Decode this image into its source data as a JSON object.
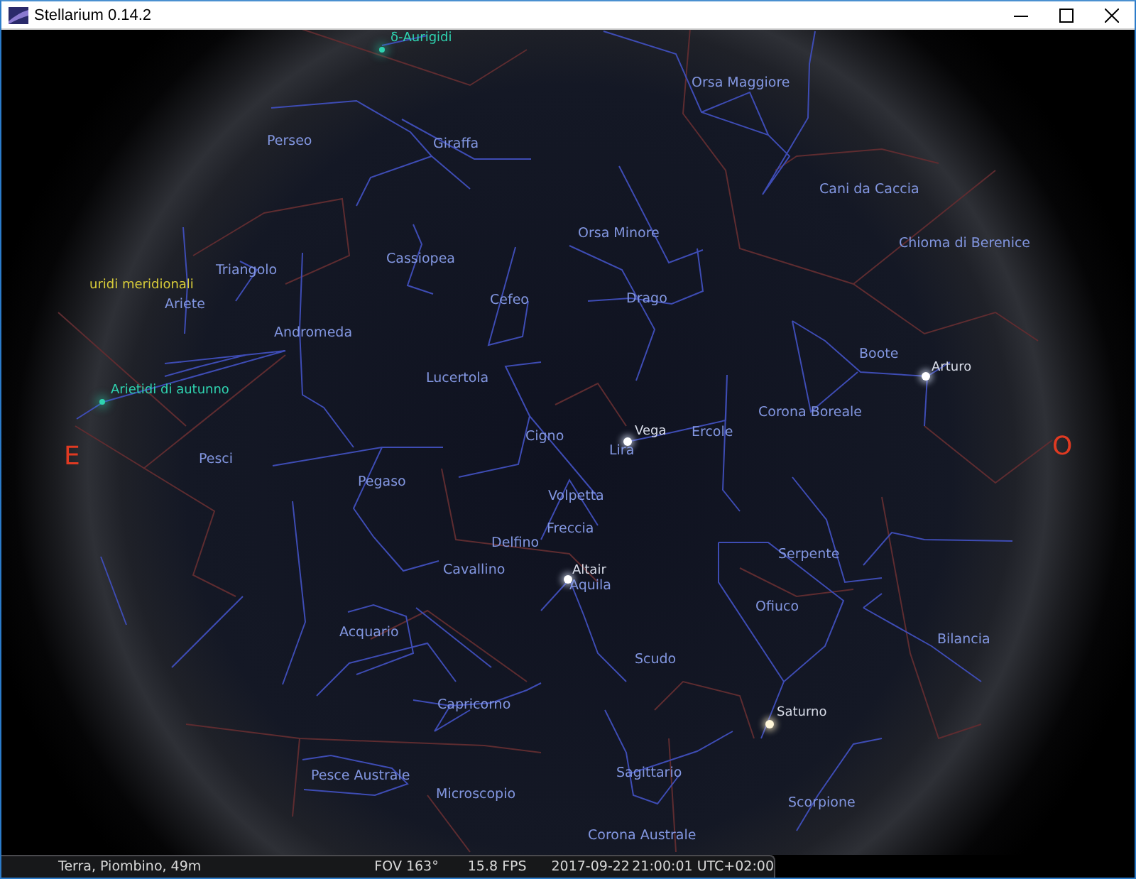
{
  "window": {
    "title": "Stellarium 0.14.2"
  },
  "sky_labels": [
    {
      "kind": "meteor_shower",
      "text": "δ-Aurigidi",
      "color": "#2fd3b0"
    },
    {
      "kind": "constellation",
      "text": "Orsa Maggiore"
    },
    {
      "kind": "constellation",
      "text": "Perseo"
    },
    {
      "kind": "constellation",
      "text": "Giraffa"
    },
    {
      "kind": "constellation",
      "text": "Cani da Caccia"
    },
    {
      "kind": "constellation",
      "text": "Orsa Minore"
    },
    {
      "kind": "constellation",
      "text": "Chioma di Berenice"
    },
    {
      "kind": "constellation",
      "text": "Cassiopea"
    },
    {
      "kind": "constellation",
      "text": "Triangolo"
    },
    {
      "kind": "meteor_shower",
      "text": "uridi meridionali",
      "color": "#d8cc3a"
    },
    {
      "kind": "constellation",
      "text": "Ariete"
    },
    {
      "kind": "constellation",
      "text": "Cefeo"
    },
    {
      "kind": "constellation",
      "text": "Drago"
    },
    {
      "kind": "constellation",
      "text": "Andromeda"
    },
    {
      "kind": "constellation",
      "text": "Boote"
    },
    {
      "kind": "star",
      "text": "Arturo"
    },
    {
      "kind": "constellation",
      "text": "Lucertola"
    },
    {
      "kind": "meteor_shower",
      "text": "Arietidi di autunno",
      "color": "#2fd3b0"
    },
    {
      "kind": "constellation",
      "text": "Corona Boreale"
    },
    {
      "kind": "constellation",
      "text": "Cigno"
    },
    {
      "kind": "star",
      "text": "Vega"
    },
    {
      "kind": "constellation",
      "text": "Ercole"
    },
    {
      "kind": "cardinal",
      "text": "E"
    },
    {
      "kind": "constellation",
      "text": "Pesci"
    },
    {
      "kind": "constellation",
      "text": "Lira"
    },
    {
      "kind": "cardinal",
      "text": "O"
    },
    {
      "kind": "constellation",
      "text": "Pegaso"
    },
    {
      "kind": "constellation",
      "text": "Volpetta"
    },
    {
      "kind": "constellation",
      "text": "Freccia"
    },
    {
      "kind": "constellation",
      "text": "Delfino"
    },
    {
      "kind": "constellation",
      "text": "Serpente"
    },
    {
      "kind": "constellation",
      "text": "Cavallino"
    },
    {
      "kind": "star",
      "text": "Altair"
    },
    {
      "kind": "constellation",
      "text": "Aquila"
    },
    {
      "kind": "constellation",
      "text": "Ofiuco"
    },
    {
      "kind": "constellation",
      "text": "Acquario"
    },
    {
      "kind": "constellation",
      "text": "Bilancia"
    },
    {
      "kind": "constellation",
      "text": "Scudo"
    },
    {
      "kind": "constellation",
      "text": "Capricorno"
    },
    {
      "kind": "planet",
      "text": "Saturno"
    },
    {
      "kind": "constellation",
      "text": "Pesce Australe"
    },
    {
      "kind": "constellation",
      "text": "Sagittario"
    },
    {
      "kind": "constellation",
      "text": "Microscopio"
    },
    {
      "kind": "constellation",
      "text": "Scorpione"
    },
    {
      "kind": "constellation",
      "text": "Corona Australe"
    }
  ],
  "status_bar": {
    "location": "Terra, Piombino, 49m",
    "fov": "FOV 163°",
    "fps": "15.8 FPS",
    "date": "2017-09-22",
    "time": "21:00:01 UTC+02:00"
  }
}
